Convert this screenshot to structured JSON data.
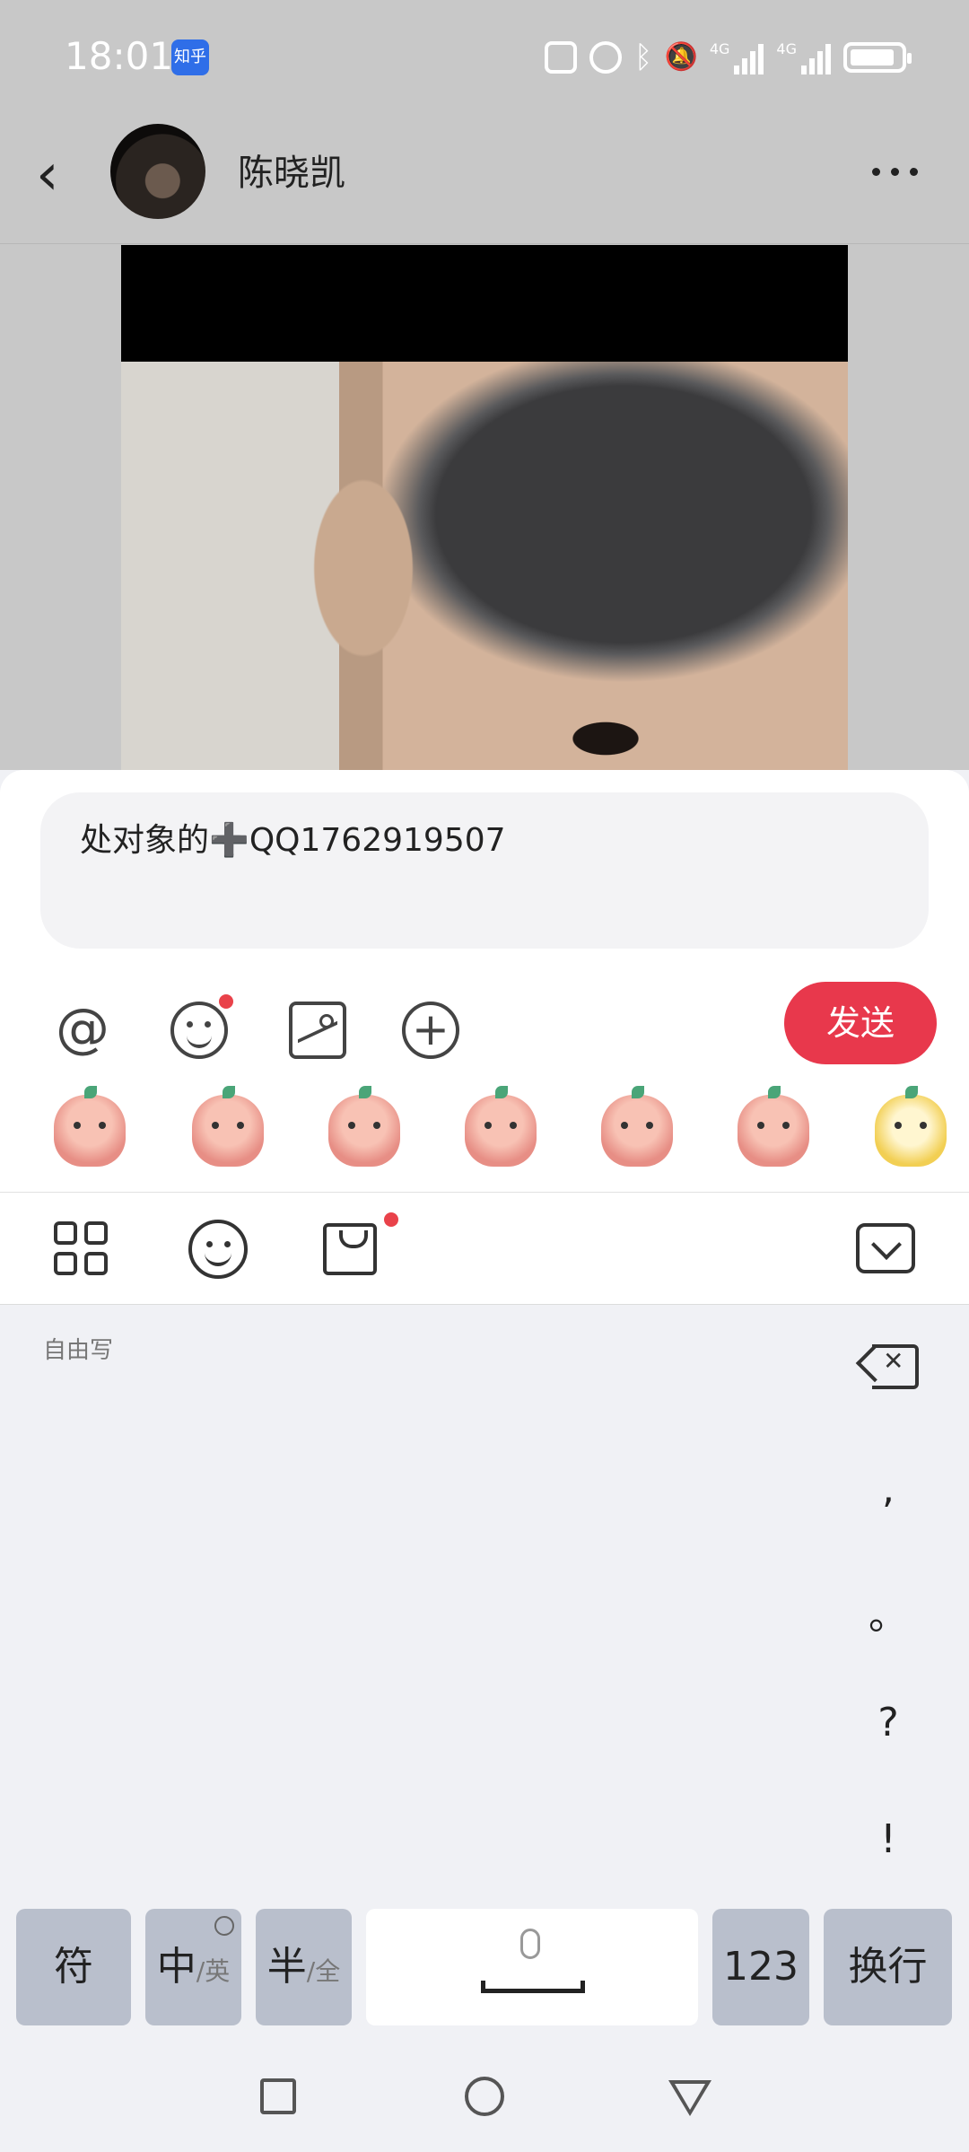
{
  "status_bar": {
    "time": "18:01",
    "app_badge": "知乎",
    "network_label_1": "4G",
    "network_label_2": "4G"
  },
  "chat": {
    "contact_name": "陈晓凯"
  },
  "compose": {
    "input_value": "处对象的➕QQ1762919507",
    "send_label": "发送"
  },
  "keyboard": {
    "mode_label": "自由写",
    "punctuation": [
      ",",
      "。",
      "?",
      "!"
    ],
    "keys": {
      "symbols": "符",
      "chinese_main": "中",
      "chinese_alt": "/英",
      "half_main": "半",
      "half_alt": "/全",
      "numbers": "123",
      "enter": "换行"
    }
  },
  "colors": {
    "accent": "#e8384c",
    "badge_blue": "#2f6ee8",
    "notification_dot": "#e9424a"
  },
  "icons": [
    "back-icon",
    "more-icon",
    "at-icon",
    "emoji-icon",
    "image-icon",
    "plus-icon",
    "grid-icon",
    "bag-icon",
    "collapse-keyboard-icon",
    "backspace-icon",
    "globe-icon",
    "mic-icon",
    "recent-apps-icon",
    "home-icon",
    "back-nav-icon"
  ]
}
